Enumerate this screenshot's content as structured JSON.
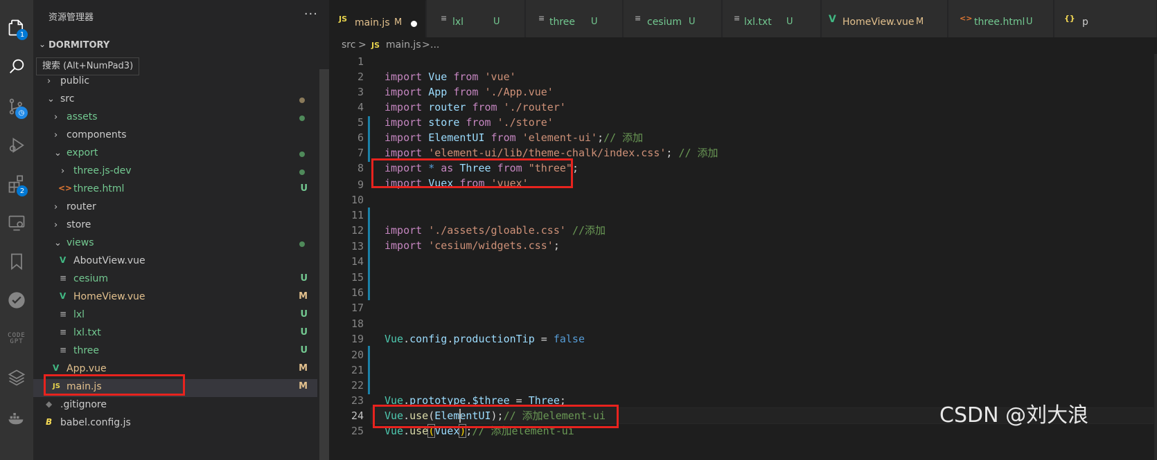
{
  "activity_bar": {
    "explorer_badge": "1",
    "extensions_badge": "2",
    "codegpt_line1": "CODE",
    "codegpt_line2": "GPT"
  },
  "tooltip": {
    "search": "搜索 (Alt+NumPad3)"
  },
  "sidebar": {
    "title": "资源管理器",
    "more": "···",
    "workspace": "DORMITORY",
    "items": [
      {
        "label": "public",
        "status": ""
      },
      {
        "label": "src",
        "status": ""
      },
      {
        "label": "assets",
        "status": ""
      },
      {
        "label": "components",
        "status": ""
      },
      {
        "label": "export",
        "status": ""
      },
      {
        "label": "three.js-dev",
        "status": ""
      },
      {
        "label": "three.html",
        "status": "U"
      },
      {
        "label": "router",
        "status": ""
      },
      {
        "label": "store",
        "status": ""
      },
      {
        "label": "views",
        "status": ""
      },
      {
        "label": "AboutView.vue",
        "status": ""
      },
      {
        "label": "cesium",
        "status": "U"
      },
      {
        "label": "HomeView.vue",
        "status": "M"
      },
      {
        "label": "lxl",
        "status": "U"
      },
      {
        "label": "lxl.txt",
        "status": "U"
      },
      {
        "label": "three",
        "status": "U"
      },
      {
        "label": "App.vue",
        "status": "M"
      },
      {
        "label": "main.js",
        "status": "M"
      },
      {
        "label": ".gitignore",
        "status": ""
      },
      {
        "label": "babel.config.js",
        "status": ""
      }
    ]
  },
  "tabs": [
    {
      "icon": "JS",
      "label": "main.js",
      "status": "M"
    },
    {
      "icon": "≡",
      "label": "lxl",
      "status": "U"
    },
    {
      "icon": "≡",
      "label": "three",
      "status": "U"
    },
    {
      "icon": "≡",
      "label": "cesium",
      "status": "U"
    },
    {
      "icon": "≡",
      "label": "lxl.txt",
      "status": "U"
    },
    {
      "icon": "V",
      "label": "HomeView.vue",
      "status": "M"
    },
    {
      "icon": "<>",
      "label": "three.html",
      "status": "U"
    },
    {
      "icon": "{}",
      "label": "p",
      "status": ""
    }
  ],
  "breadcrumb": {
    "folder": "src",
    "sep": ">",
    "icon": "JS",
    "file": "main.js",
    "more": "..."
  },
  "editor": {
    "line_numbers": [
      "1",
      "2",
      "3",
      "4",
      "5",
      "6",
      "7",
      "8",
      "9",
      "10",
      "11",
      "12",
      "13",
      "14",
      "15",
      "16",
      "17",
      "18",
      "19",
      "20",
      "21",
      "22",
      "23",
      "24",
      "25"
    ],
    "l1": [
      "import",
      "Vue",
      "from",
      "'vue'"
    ],
    "l2": [
      "import",
      "App",
      "from",
      "'./App.vue'"
    ],
    "l3": [
      "import",
      "router",
      "from",
      "'./router'"
    ],
    "l4": [
      "import",
      "store",
      "from",
      "'./store'"
    ],
    "l5": [
      "import",
      "ElementUI",
      "from",
      "'element-ui'",
      ";",
      "// 添加"
    ],
    "l6": [
      "import",
      "'element-ui/lib/theme-chalk/index.css'",
      ";",
      "// 添加"
    ],
    "l7": [
      "import",
      "*",
      "as",
      "Three",
      "from",
      "\"three\"",
      ";"
    ],
    "l8": [
      "import",
      "Vuex",
      "from",
      "'vuex'"
    ],
    "l11": [
      "import",
      "'./assets/gloable.css'",
      "//添加"
    ],
    "l12": [
      "import",
      "'cesium/widgets.css'",
      ";"
    ],
    "l18": [
      "Vue",
      ".",
      "config",
      ".",
      "productionTip",
      " = ",
      "false"
    ],
    "l22": [
      "Vue",
      ".",
      "prototype",
      ".",
      "$three",
      " = ",
      "Three",
      ";"
    ],
    "l23": [
      "Vue",
      ".",
      "use",
      "(",
      "ElementUI",
      ");",
      "// 添加element-ui"
    ],
    "l24": [
      "Vue",
      ".",
      "use",
      "(",
      "Vuex",
      ")",
      ";",
      "// 添加element-ui"
    ]
  },
  "watermark": "CSDN @刘大浪",
  "colors": {
    "accent": "#0078d4",
    "highlight_box": "#e8231e",
    "modified": "#e2c08d",
    "untracked": "#73c991"
  }
}
